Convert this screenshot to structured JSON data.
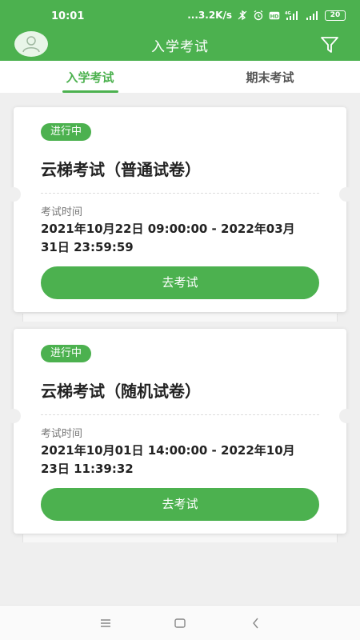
{
  "status_bar": {
    "time": "10:01",
    "net_speed": "...3.2K/s",
    "battery": "20"
  },
  "header": {
    "title": "入学考试"
  },
  "tabs": [
    {
      "label": "入学考试",
      "active": true
    },
    {
      "label": "期末考试",
      "active": false
    }
  ],
  "exams": [
    {
      "status": "进行中",
      "name": "云梯考试（普通试卷）",
      "time_label": "考试时间",
      "time_range": "2021年10月22日 09:00:00 - 2022年03月31日 23:59:59",
      "action_label": "去考试"
    },
    {
      "status": "进行中",
      "name": "云梯考试（随机试卷）",
      "time_label": "考试时间",
      "time_range": "2021年10月01日 14:00:00 - 2022年10月23日 11:39:32",
      "action_label": "去考试"
    }
  ],
  "colors": {
    "brand": "#4cb14f",
    "background": "#efefef"
  },
  "icons": {
    "avatar": "user-avatar-icon",
    "filter": "filter-icon",
    "nav_menu": "menu-icon",
    "nav_home": "home-icon",
    "nav_back": "back-icon"
  }
}
